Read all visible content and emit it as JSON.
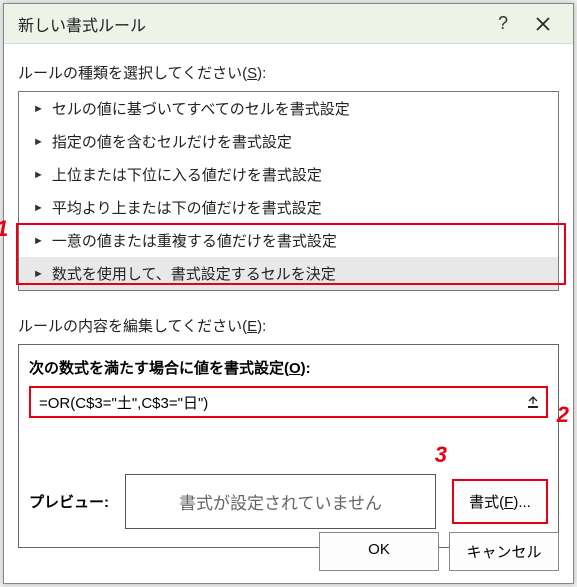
{
  "titlebar": {
    "title": "新しい書式ルール"
  },
  "labels": {
    "select_rule_type_pre": "ルールの種類を選択してください(",
    "select_rule_type_key": "S",
    "select_rule_type_post": "):",
    "edit_rule_pre": "ルールの内容を編集してください(",
    "edit_rule_key": "E",
    "edit_rule_post": "):",
    "formula_label_pre": "次の数式を満たす場合に値を書式設定(",
    "formula_label_key": "O",
    "formula_label_post": "):",
    "preview": "プレビュー:",
    "preview_text": "書式が設定されていません",
    "format_btn_pre": "書式(",
    "format_btn_key": "F",
    "format_btn_post": ")..."
  },
  "rule_types": [
    "セルの値に基づいてすべてのセルを書式設定",
    "指定の値を含むセルだけを書式設定",
    "上位または下位に入る値だけを書式設定",
    "平均より上または下の値だけを書式設定",
    "一意の値または重複する値だけを書式設定",
    "数式を使用して、書式設定するセルを決定"
  ],
  "formula": {
    "value": "=OR(C$3=\"土\",C$3=\"日\")"
  },
  "buttons": {
    "ok": "OK",
    "cancel": "キャンセル"
  },
  "annotations": {
    "a1": "1",
    "a2": "2",
    "a3": "3"
  }
}
